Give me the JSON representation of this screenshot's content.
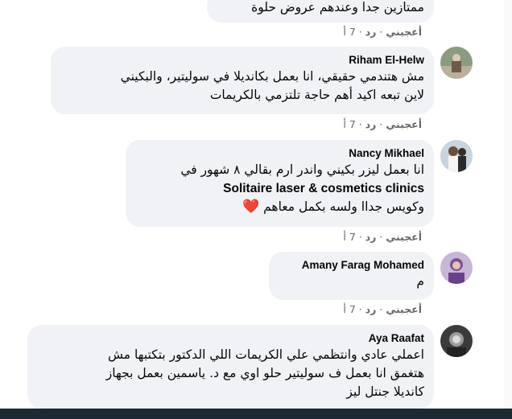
{
  "comments": [
    {
      "text_lines": [
        "ممتازين جدا وعندهم عروض حلوة"
      ],
      "meta": {
        "like": "أعجبني",
        "reply": "رد",
        "time": "7 أ"
      }
    },
    {
      "name": "Riham El-Helw",
      "text_lines": [
        "مش هتندمي حقيقي، انا بعمل بكانديلا في سوليتير، والبكيني",
        "لاين تبعه اكيد أهم حاجة تلتزمي بالكريمات"
      ],
      "meta": {
        "like": "أعجبني",
        "reply": "رد",
        "time": "7 أ"
      }
    },
    {
      "name": "Nancy Mikhael",
      "text_lines": [
        "انا بعمل ليزر بكيني واندر ارم بقالي ٨ شهور في",
        "Solitaire laser & cosmetics clinics",
        "وكويس جداا ولسه بكمل معاهم"
      ],
      "emoji": "❤️",
      "meta": {
        "like": "أعجبني",
        "reply": "رد",
        "time": "7 أ"
      }
    },
    {
      "name": "Amany Farag Mohamed",
      "text_lines": [
        "م"
      ],
      "meta": {
        "like": "أعجبني",
        "reply": "رد",
        "time": "7 أ"
      }
    },
    {
      "name": "Aya Raafat",
      "text_lines": [
        "اعملي عادي وانتظمي علي الكريمات اللي الدكتور بتكتبها مش",
        "هتغمق انا بعمل ف سوليتير حلو اوي مع د. ياسمين بعمل بجهاز",
        "كانديلا جنتل ليز"
      ],
      "meta": {
        "like": "",
        "reply": "",
        "time": ""
      }
    }
  ],
  "separator": "·",
  "colors": {
    "bubble": "#f0f2f5",
    "meta": "#65676b",
    "bottom_bar": "#1c2b33"
  }
}
